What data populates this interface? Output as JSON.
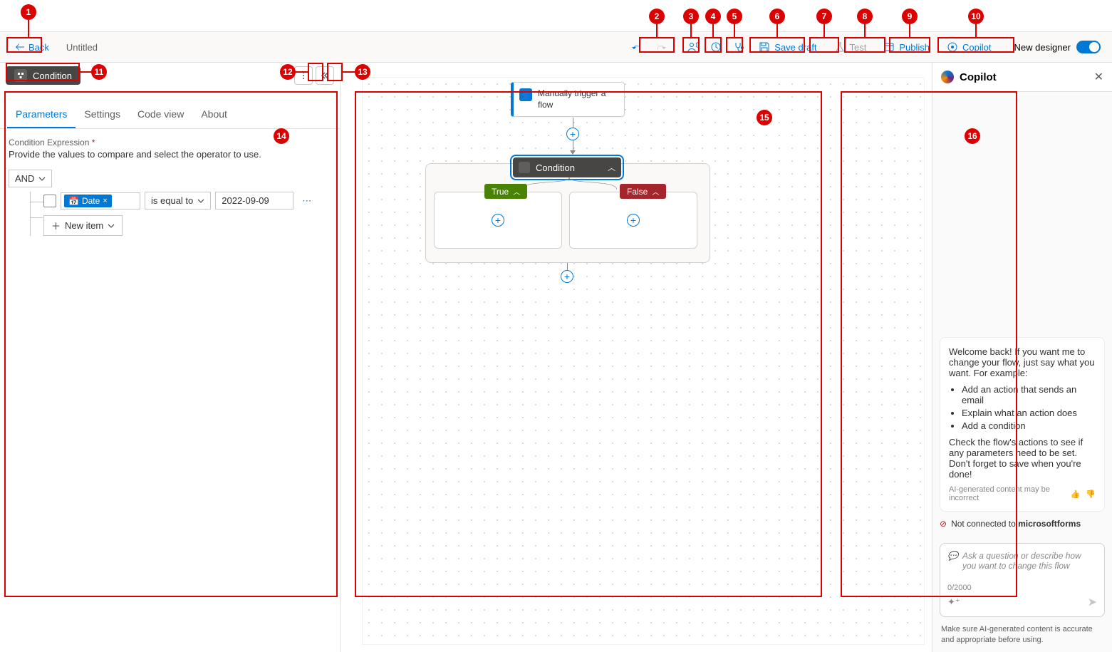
{
  "topbar": {
    "back_label": "Back",
    "flow_title": "Untitled",
    "save_draft": "Save draft",
    "test": "Test",
    "publish": "Publish",
    "copilot": "Copilot",
    "new_designer": "New designer"
  },
  "panel": {
    "action_name": "Condition",
    "tabs": {
      "parameters": "Parameters",
      "settings": "Settings",
      "code_view": "Code view",
      "about": "About"
    },
    "field_label": "Condition Expression",
    "field_desc": "Provide the values to compare and select the operator to use.",
    "logic_op": "AND",
    "row": {
      "token_label": "Date",
      "operator": "is equal to",
      "value": "2022-09-09"
    },
    "new_item": "New item"
  },
  "canvas": {
    "trigger_label": "Manually trigger a flow",
    "condition_label": "Condition",
    "true_label": "True",
    "false_label": "False"
  },
  "copilot": {
    "title": "Copilot",
    "welcome_p1": "Welcome back! If you want me to change your flow, just say what you want. For example:",
    "ex1": "Add an action that sends an email",
    "ex2": "Explain what an action does",
    "ex3": "Add a condition",
    "welcome_p2": "Check the flow's actions to see if any parameters need to be set. Don't forget to save when you're done!",
    "ai_disclaimer": "AI-generated content may be incorrect",
    "warn_prefix": "Not connected to ",
    "warn_bold": "microsoftforms",
    "placeholder": "Ask a question or describe how you want to change this flow",
    "counter": "0/2000",
    "footer": "Make sure AI-generated content is accurate and appropriate before using."
  },
  "annotations": {
    "1": "1",
    "2": "2",
    "3": "3",
    "4": "4",
    "5": "5",
    "6": "6",
    "7": "7",
    "8": "8",
    "9": "9",
    "10": "10",
    "11": "11",
    "12": "12",
    "13": "13",
    "14": "14",
    "15": "15",
    "16": "16"
  }
}
